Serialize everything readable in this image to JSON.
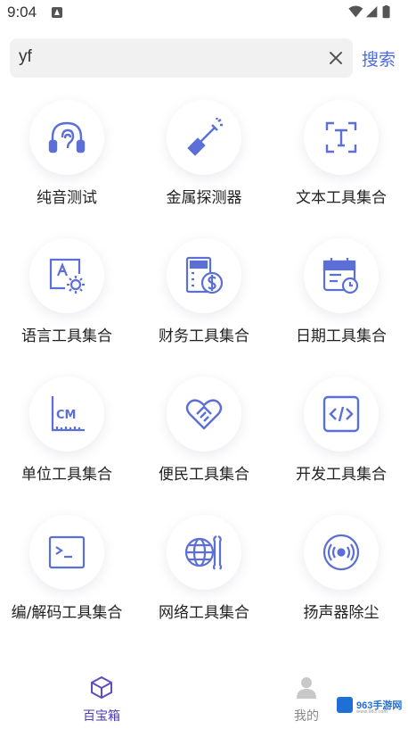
{
  "status_bar": {
    "time": "9:04"
  },
  "search": {
    "value": "yf",
    "button_label": "搜索"
  },
  "tools": [
    {
      "label": "纯音测试",
      "icon": "headphones-ear-icon"
    },
    {
      "label": "金属探测器",
      "icon": "metal-detector-icon"
    },
    {
      "label": "文本工具集合",
      "icon": "text-scan-icon"
    },
    {
      "label": "语言工具集合",
      "icon": "language-settings-icon"
    },
    {
      "label": "财务工具集合",
      "icon": "finance-calculator-icon"
    },
    {
      "label": "日期工具集合",
      "icon": "calendar-clock-icon"
    },
    {
      "label": "单位工具集合",
      "icon": "ruler-cm-icon"
    },
    {
      "label": "便民工具集合",
      "icon": "heart-handshake-icon"
    },
    {
      "label": "开发工具集合",
      "icon": "code-icon"
    },
    {
      "label": "编/解码工具集合",
      "icon": "terminal-icon"
    },
    {
      "label": "网络工具集合",
      "icon": "globe-wrench-icon"
    },
    {
      "label": "扬声器除尘",
      "icon": "speaker-waves-icon"
    }
  ],
  "nav": [
    {
      "label": "百宝箱",
      "icon": "cube-icon",
      "active": true
    },
    {
      "label": "我的",
      "icon": "person-icon",
      "active": false
    }
  ],
  "watermark": {
    "text": "963手游网",
    "sub": "www.963.com"
  },
  "colors": {
    "accent": "#4f6cd8",
    "nav_active": "#4a3bb8",
    "icon_stroke": "#5b6fd6"
  }
}
